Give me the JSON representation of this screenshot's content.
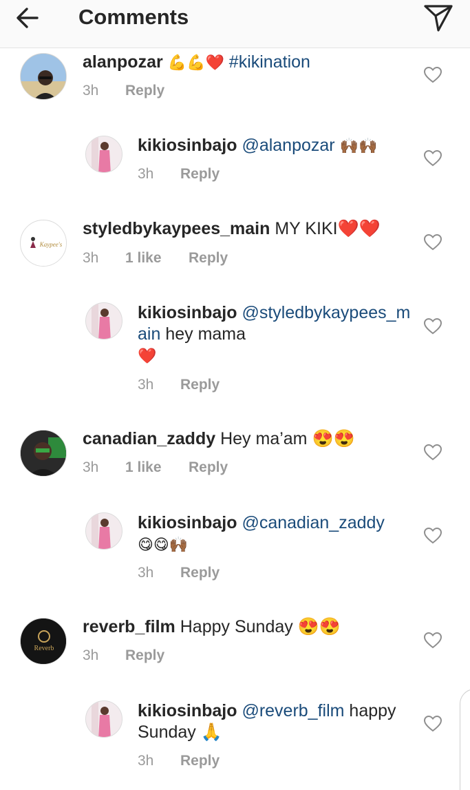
{
  "header": {
    "title": "Comments",
    "back_icon": "arrow-left-icon",
    "send_icon": "paper-plane-icon"
  },
  "colors": {
    "mention": "#1a4b7a",
    "meta": "#9a9a9a",
    "heart_emoji": "#e0202e"
  },
  "comments": [
    {
      "username": "alanpozar",
      "body": "💪💪❤️",
      "tag": "#kikination",
      "time": "3h",
      "likes": "",
      "reply_label": "Reply",
      "avatar": "alanpozar-avatar",
      "reply": {
        "username": "kikiosinbajo",
        "mention": "@alanpozar",
        "body": "🙌🏾🙌🏾",
        "time": "3h",
        "reply_label": "Reply"
      }
    },
    {
      "username": "styledbykaypees_main",
      "body": "MY KIKI❤️❤️",
      "time": "3h",
      "likes": "1 like",
      "reply_label": "Reply",
      "avatar_text": "Kaypee's",
      "reply": {
        "username": "kikiosinbajo",
        "mention": "@styledbykaypees_main",
        "body": "hey mama",
        "body2": "❤️",
        "time": "3h",
        "reply_label": "Reply"
      }
    },
    {
      "username": "canadian_zaddy",
      "body": "Hey ma’am 😍😍",
      "time": "3h",
      "likes": "1 like",
      "reply_label": "Reply",
      "reply": {
        "username": "kikiosinbajo",
        "mention": "@canadian_zaddy",
        "body": "😋😋🙌🏾",
        "time": "3h",
        "reply_label": "Reply"
      }
    },
    {
      "username": "reverb_film",
      "body": "Happy Sunday 😍😍",
      "time": "3h",
      "likes": "",
      "reply_label": "Reply",
      "avatar_text": "Reverb",
      "reply": {
        "username": "kikiosinbajo",
        "mention": "@reverb_film",
        "body": "happy Sunday 🙏",
        "time": "3h",
        "reply_label": "Reply"
      }
    }
  ]
}
